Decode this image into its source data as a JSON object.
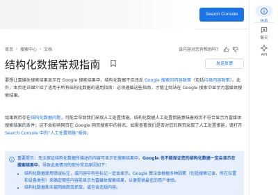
{
  "topbar": {
    "search_console_label": "Search Console"
  },
  "breadcrumb": {
    "items": [
      "首页",
      "搜索中心",
      "文档"
    ]
  },
  "helpful": {
    "question": "该内容对您有帮助吗？"
  },
  "page": {
    "title": "结构化数据常规指南",
    "feedback_label": "发送反馈"
  },
  "para1": {
    "t1": "要想让富媒体搜索结果显示在 Google 搜索结果中，结构化数据不应违反 ",
    "link1": "Google 搜索的内容政策",
    "t2": "（包括",
    "link2": "垃圾内容政策",
    "t3": "）。此外，本页还详细介绍了适用于所有结构化数据的通用指南：必须遵循这些指南，才能让网站在 Google 搜索中显示为富媒体搜索结果。"
  },
  "para2": {
    "t1": "如果网页存在",
    "link1": "结构化数据问题",
    "t2": "，可能会导致我们采取人工处置措施。结构化数据人工处置措施意味着网页不符合显示为富媒体搜索结果的条件；这不会影响网页在 Google 网页搜索中的排名。如需查看我们是否对您的网页采取了人工处置措施，请打开 ",
    "link2": "Search Console 中的“人工处置措施”报告",
    "t3": "。"
  },
  "note": {
    "lead": "重要提示：",
    "t1": "无法保证结构化数据所描述的内容可显示在搜索结果中。",
    "bold": "Google 也不能保证您的结构化数据一定会显示在搜索结果中",
    "t2": "。导致此类情况的部分常见原因如下：",
    "bullets": [
      "结构化数据使用错误标注，或内容中有些标记一定会显示。Google 算法会根据多种因素（包括搜索记录、所在位置和设备类型）来确定哪些内容能显示为富媒体搜索结果，以便提供最佳的用户体验。",
      "结构化数据和未被网络爬虫抓取，或包含违规内容。"
    ]
  },
  "rail": {
    "info_label": "信息",
    "chat_label": "聊天",
    "api_label": "API"
  },
  "colors": {
    "accent": "#1a73e8",
    "note_bg": "#e8f0fe",
    "text": "#202124"
  }
}
